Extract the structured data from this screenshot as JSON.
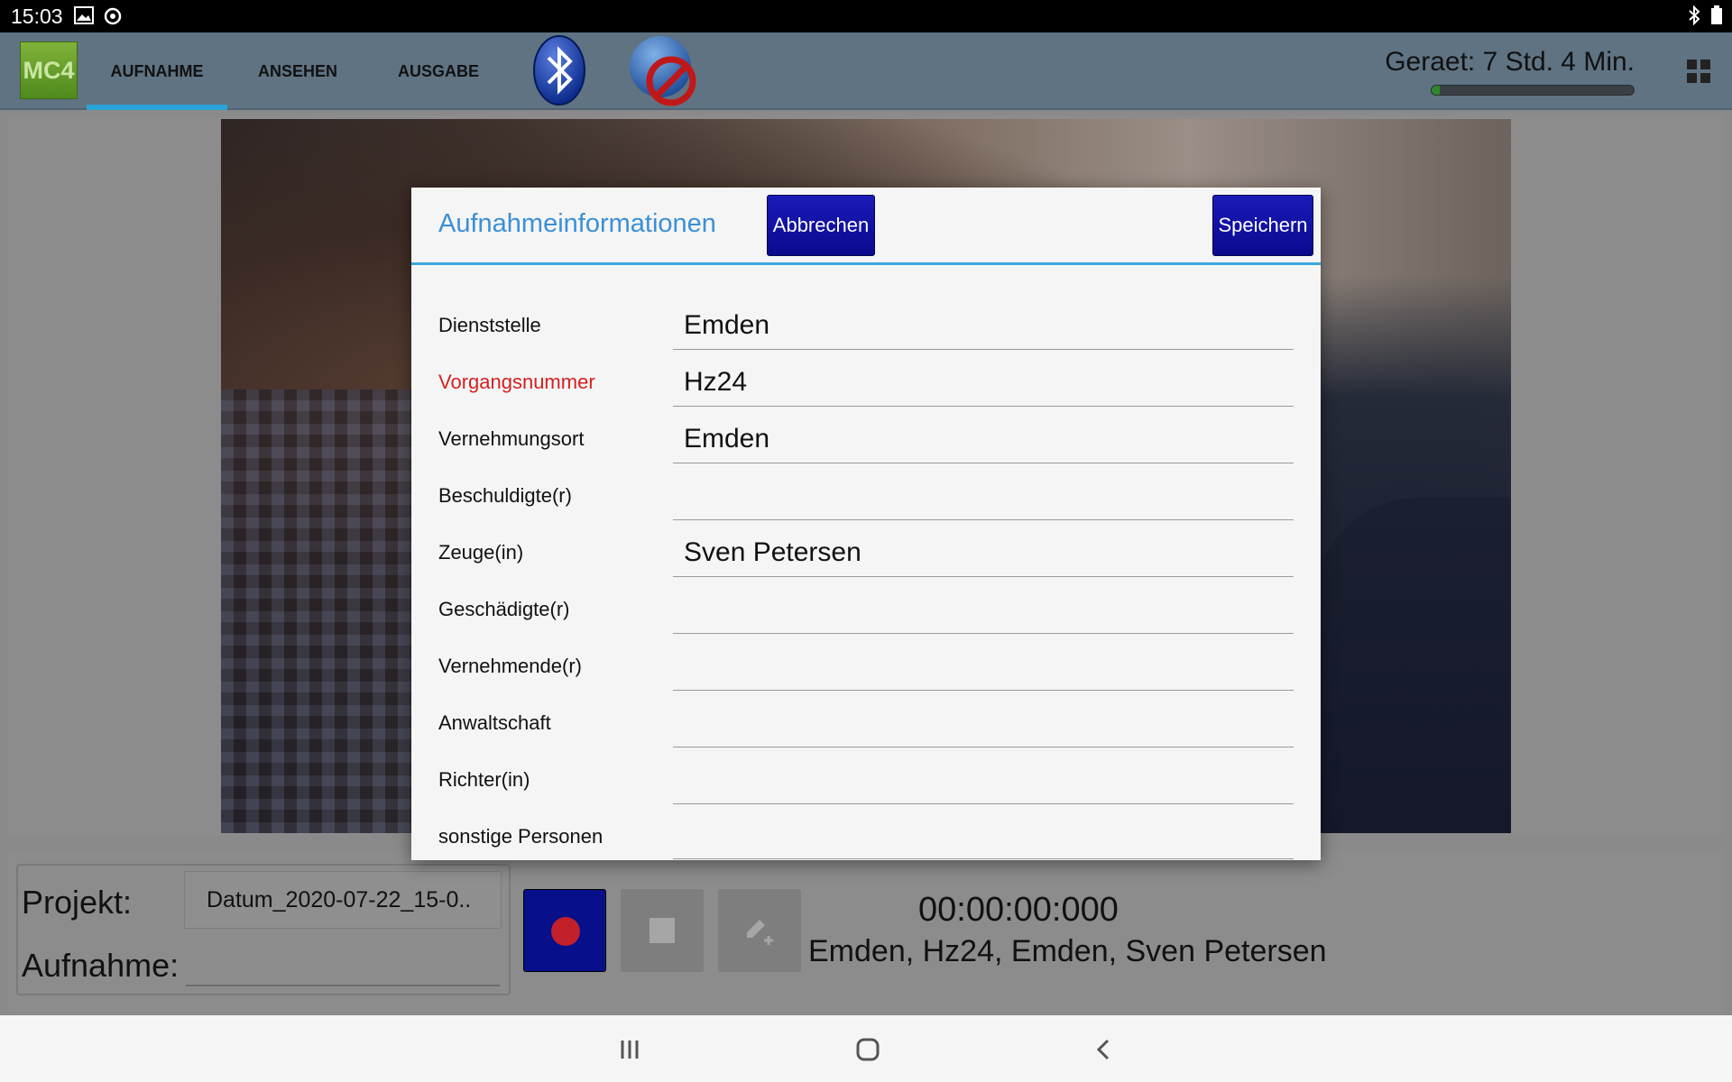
{
  "status_bar": {
    "time": "15:03",
    "icons": [
      "image-icon",
      "sync-icon",
      "bluetooth-icon",
      "battery-icon"
    ]
  },
  "app_bar": {
    "logo": "MC4",
    "tabs": [
      {
        "label": "AUFNAHME",
        "active": true
      },
      {
        "label": "ANSEHEN",
        "active": false
      },
      {
        "label": "AUSGABE",
        "active": false
      }
    ],
    "device_label": "Geraet: 7 Std. 4 Min.",
    "device_progress": 0.04
  },
  "dialog": {
    "title": "Aufnahmeinformationen",
    "cancel_label": "Abbrechen",
    "save_label": "Speichern",
    "fields": [
      {
        "label": "Dienststelle",
        "value": "Emden",
        "required": false
      },
      {
        "label": "Vorgangsnummer",
        "value": "Hz24",
        "required": true
      },
      {
        "label": "Vernehmungsort",
        "value": "Emden",
        "required": false
      },
      {
        "label": "Beschuldigte(r)",
        "value": "",
        "required": false
      },
      {
        "label": "Zeuge(in)",
        "value": "Sven Petersen",
        "required": false
      },
      {
        "label": "Geschädigte(r)",
        "value": "",
        "required": false
      },
      {
        "label": "Vernehmende(r)",
        "value": "",
        "required": false
      },
      {
        "label": "Anwaltschaft",
        "value": "",
        "required": false
      },
      {
        "label": "Richter(in)",
        "value": "",
        "required": false
      },
      {
        "label": "sonstige Personen",
        "value": "",
        "required": false
      }
    ]
  },
  "bottom": {
    "project_label": "Projekt:",
    "project_value": "Datum_2020-07-22_15-0..",
    "recording_label": "Aufnahme:",
    "recording_value": "",
    "timer": "00:00:00:000",
    "summary": "Emden, Hz24, Emden, Sven Petersen"
  },
  "colors": {
    "accent": "#3ba7dd",
    "button_blue": "#0a0a8e",
    "required_red": "#d42020",
    "app_bar": "#5f7383"
  }
}
